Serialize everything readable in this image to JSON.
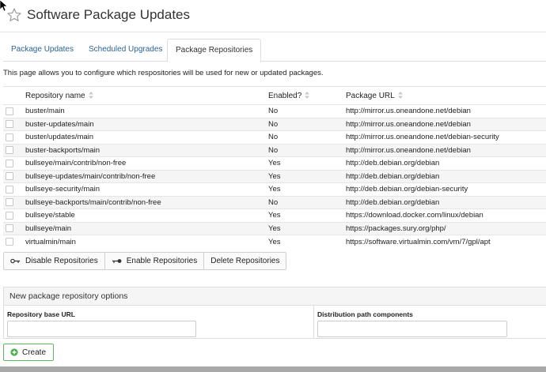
{
  "page": {
    "title": "Software Package Updates"
  },
  "tabs": [
    {
      "label": "Package Updates",
      "active": false
    },
    {
      "label": "Scheduled Upgrades",
      "active": false
    },
    {
      "label": "Package Repositories",
      "active": true
    }
  ],
  "intro_text": "This page allows you to configure which respositories will be used for new or updated packages.",
  "table": {
    "headers": {
      "name": "Repository name",
      "enabled": "Enabled?",
      "url": "Package URL"
    },
    "rows": [
      {
        "name": "buster/main",
        "enabled": "No",
        "url": "http://mirror.us.oneandone.net/debian"
      },
      {
        "name": "buster-updates/main",
        "enabled": "No",
        "url": "http://mirror.us.oneandone.net/debian"
      },
      {
        "name": "buster/updates/main",
        "enabled": "No",
        "url": "http://mirror.us.oneandone.net/debian-security"
      },
      {
        "name": "buster-backports/main",
        "enabled": "No",
        "url": "http://mirror.us.oneandone.net/debian"
      },
      {
        "name": "bullseye/main/contrib/non-free",
        "enabled": "Yes",
        "url": "http://deb.debian.org/debian"
      },
      {
        "name": "bullseye-updates/main/contrib/non-free",
        "enabled": "Yes",
        "url": "http://deb.debian.org/debian"
      },
      {
        "name": "bullseye-security/main",
        "enabled": "Yes",
        "url": "http://deb.debian.org/debian-security"
      },
      {
        "name": "bullseye-backports/main/contrib/non-free",
        "enabled": "No",
        "url": "http://deb.debian.org/debian"
      },
      {
        "name": "bullseye/stable",
        "enabled": "Yes",
        "url": "https://download.docker.com/linux/debian"
      },
      {
        "name": "bullseye/main",
        "enabled": "Yes",
        "url": "https://packages.sury.org/php/"
      },
      {
        "name": "virtualmin/main",
        "enabled": "Yes",
        "url": "https://software.virtualmin.com/vm/7/gpl/apt"
      }
    ]
  },
  "actions": {
    "disable": "Disable Repositories",
    "enable": "Enable Repositories",
    "delete": "Delete Repositories"
  },
  "new_repo": {
    "heading": "New package repository options",
    "base_url_label": "Repository base URL",
    "base_url_value": "",
    "dist_label": "Distribution path components",
    "dist_value": ""
  },
  "create_label": "Create",
  "colors": {
    "yes": "#2b8a2b",
    "no": "#c9302c",
    "link": "#2a6496",
    "create_border": "#5cb85c"
  },
  "icons": {
    "title": "star-outline-icon",
    "disable": "key-off-icon",
    "enable": "key-on-icon",
    "create": "plus-circle-icon",
    "sort": "sort-icon"
  }
}
